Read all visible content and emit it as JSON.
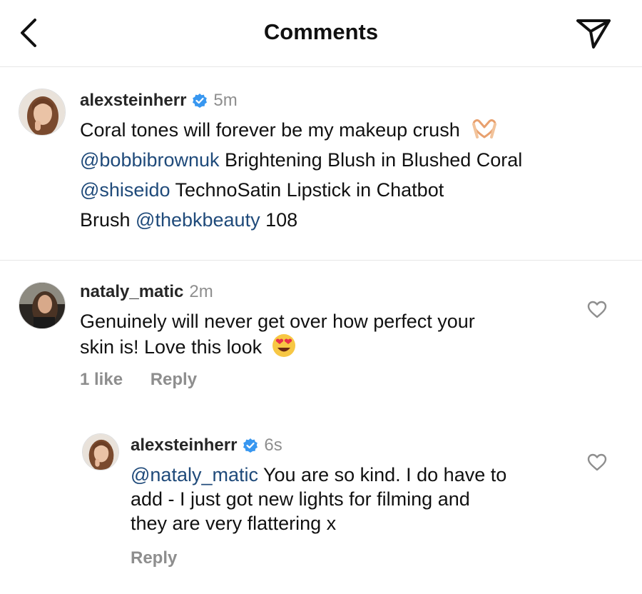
{
  "header": {
    "title": "Comments",
    "back_icon": "chevron-left-icon",
    "share_icon": "paper-plane-icon"
  },
  "caption": {
    "username": "alexsteinherr",
    "verified": true,
    "time": "5m",
    "lines": {
      "l1_text": "Coral tones will forever be my makeup crush",
      "l1_emoji": "heart-hands-emoji",
      "l2_mention": "@bobbibrownuk",
      "l2_text": " Brightening Blush in Blushed Coral",
      "l3_mention": "@shiseido",
      "l3_text": " TechnoSatin Lipstick in Chatbot",
      "l4_text": "Brush ",
      "l4_mention": "@thebkbeauty",
      "l4_text2": " 108"
    }
  },
  "comment1": {
    "username": "nataly_matic",
    "time": "2m",
    "line1": "Genuinely will never get over how perfect your",
    "line2": "skin is! Love this look",
    "emoji": "heart-eyes-emoji",
    "likes": "1 like",
    "reply_label": "Reply"
  },
  "reply1": {
    "username": "alexsteinherr",
    "verified": true,
    "time": "6s",
    "mention": "@nataly_matic",
    "line1": " You are so kind. I do have to",
    "line2": "add - I just got new lights for filming and",
    "line3": "they are very flattering x",
    "reply_label": "Reply"
  },
  "colors": {
    "mention": "#1f4a7a",
    "verified": "#3897f0",
    "muted": "#8e8e8e"
  }
}
